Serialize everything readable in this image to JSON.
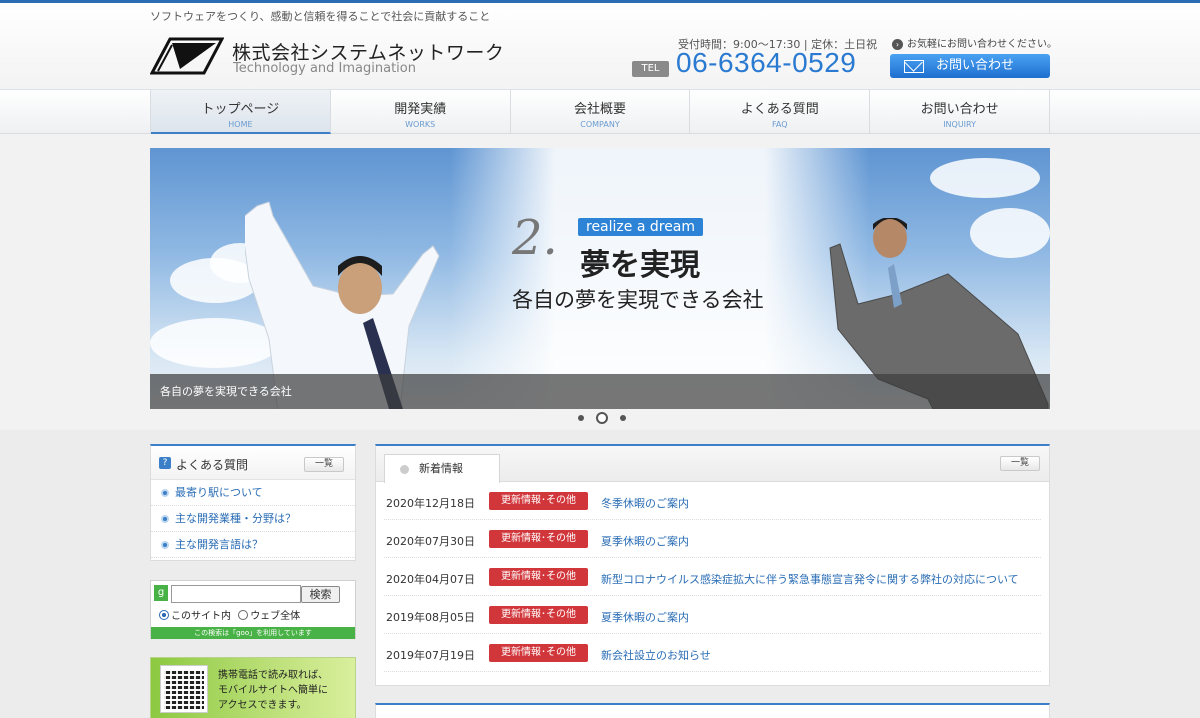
{
  "header": {
    "tagline": "ソフトウェアをつくり、感動と信頼を得ることで社会に貢献すること",
    "company_name": "株式会社システムネットワーク",
    "company_sub": "Technology and Imagination",
    "hours": "受付時間：9:00～17:30 | 定休：土日祝",
    "tel_label": "TEL",
    "tel_number": "06-6364-0529",
    "contact_note": "お気軽にお問い合わせください。",
    "contact_button": "お問い合わせ",
    "accent_color": "#2a6db5"
  },
  "nav": [
    {
      "label": "トップページ",
      "sub": "HOME"
    },
    {
      "label": "開発実績",
      "sub": "WORKS"
    },
    {
      "label": "会社概要",
      "sub": "COMPANY"
    },
    {
      "label": "よくある質問",
      "sub": "FAQ"
    },
    {
      "label": "お問い合わせ",
      "sub": "INQUIRY"
    }
  ],
  "hero": {
    "number": "2.",
    "badge": "realize a dream",
    "title": "夢を実現",
    "subtitle": "各自の夢を実現できる会社",
    "caption": "各自の夢を実現できる会社",
    "active_slide": 2
  },
  "faq": {
    "title": "よくある質問",
    "list_button": "一覧",
    "items": [
      "最寄り駅について",
      "主な開発業種・分野は？",
      "主な開発言語は？"
    ]
  },
  "search": {
    "icon_letter": "g",
    "button": "検索",
    "option_site": "このサイト内",
    "option_web": "ウェブ全体",
    "note": "この検索は「goo」を利用しています"
  },
  "mobile": {
    "line1": "携帯電話で読み取れば、",
    "line2": "モバイルサイトへ簡単に",
    "line3": "アクセスできます。"
  },
  "news": {
    "tab": "新着情報",
    "list_button": "一覧",
    "tag_color": "#d1363a",
    "items": [
      {
        "date": "2020年12月18日",
        "tag": "更新情報･その他",
        "title": "冬季休暇のご案内"
      },
      {
        "date": "2020年07月30日",
        "tag": "更新情報･その他",
        "title": "夏季休暇のご案内"
      },
      {
        "date": "2020年04月07日",
        "tag": "更新情報･その他",
        "title": "新型コロナウイルス感染症拡大に伴う緊急事態宣言発令に関する弊社の対応について"
      },
      {
        "date": "2019年08月05日",
        "tag": "更新情報･その他",
        "title": "夏季休暇のご案内"
      },
      {
        "date": "2019年07月19日",
        "tag": "更新情報･その他",
        "title": "新会社設立のお知らせ"
      }
    ]
  }
}
